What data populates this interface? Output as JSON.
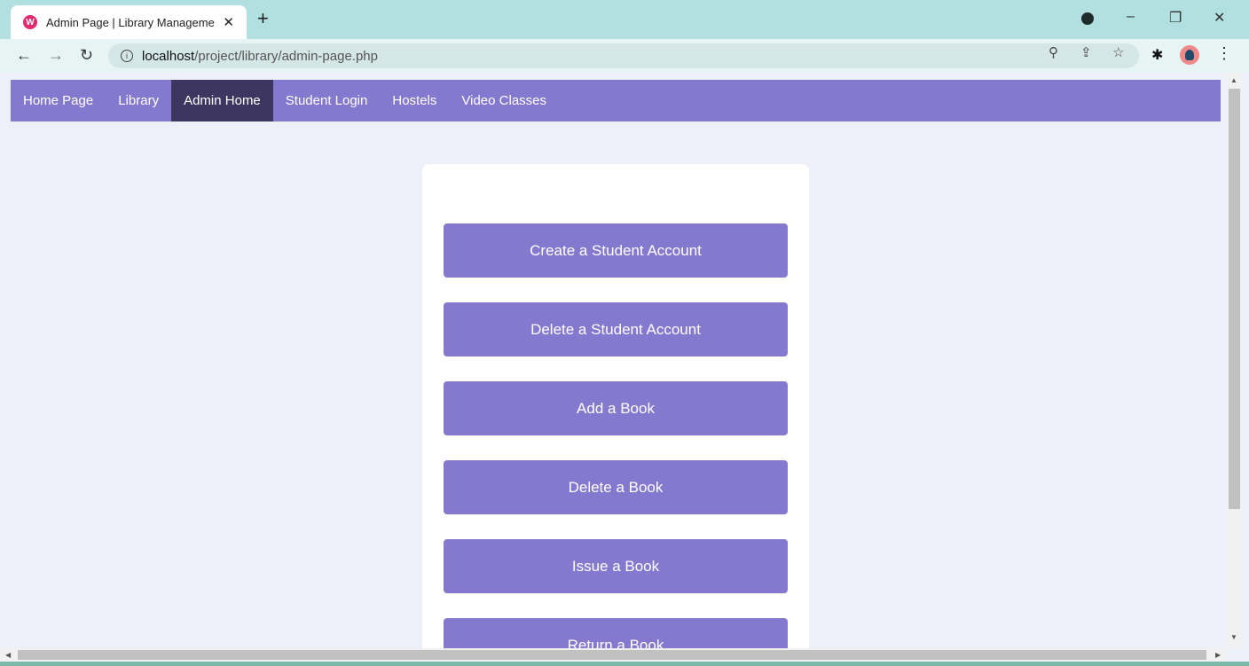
{
  "browser": {
    "tab_title": "Admin Page | Library Manageme",
    "tab_close": "✕",
    "new_tab": "+",
    "url_host": "localhost",
    "url_path": "/project/library/admin-page.php",
    "minimize": "–",
    "restore": "❐",
    "close": "✕",
    "icons": [
      "back-icon",
      "forward-icon",
      "reload-icon",
      "info-icon",
      "zoom-icon",
      "share-icon",
      "star-icon",
      "extensions-icon",
      "avatar",
      "menu-icon"
    ]
  },
  "nav": {
    "items": [
      {
        "label": "Home Page",
        "active": false
      },
      {
        "label": "Library",
        "active": false
      },
      {
        "label": "Admin Home",
        "active": true
      },
      {
        "label": "Student Login",
        "active": false
      },
      {
        "label": "Hostels",
        "active": false
      },
      {
        "label": "Video Classes",
        "active": false
      }
    ]
  },
  "actions": [
    "Create a Student Account",
    "Delete a Student Account",
    "Add a Book",
    "Delete a Book",
    "Issue a Book",
    "Return a Book"
  ],
  "colors": {
    "nav_bg": "#8579cf",
    "nav_active": "#3d3660",
    "button_bg": "#8579cf",
    "page_bg": "#eef0f9",
    "tabbar_bg": "#b2dfdf"
  }
}
